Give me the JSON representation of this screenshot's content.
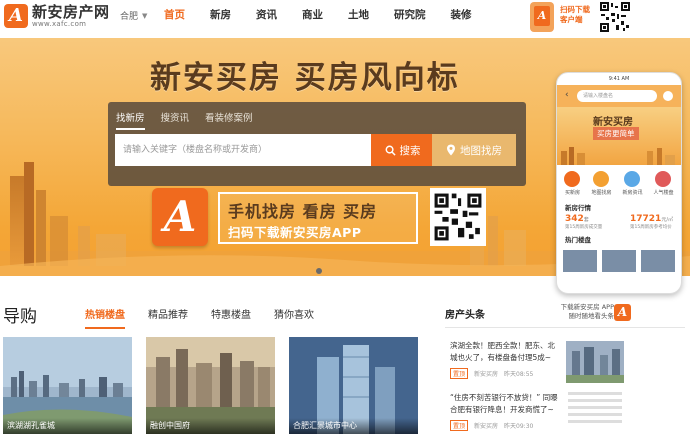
{
  "logo": {
    "name": "新安房产网",
    "url": "www.xafc.com",
    "mark": "A"
  },
  "city": {
    "label": "合肥"
  },
  "nav": {
    "items": [
      "首页",
      "新房",
      "资讯",
      "商业",
      "土地",
      "研究院",
      "装修"
    ],
    "active_index": 0
  },
  "app_download": {
    "line1": "扫码下载",
    "line2": "客户端"
  },
  "banner": {
    "slogan": "新安买房  买房风向标",
    "search": {
      "tabs": [
        "找新房",
        "搜资讯",
        "看装修案例"
      ],
      "active_tab": 0,
      "placeholder": "请输入关键字（楼盘名称或开发商）",
      "search_label": "搜索",
      "map_label": "地图找房"
    },
    "promo": {
      "line1": "手机找房  看房  买房",
      "line2": "扫码下载新安买房APP"
    }
  },
  "phone": {
    "status": "9:41 AM",
    "search_placeholder": "请输入楼盘名",
    "hero_title": "新安买房",
    "hero_sub": "买房更简单",
    "icons": [
      "买新房",
      "地图找房",
      "新房资讯",
      "人气楼盘"
    ],
    "market_title": "新房行情",
    "stat1_value": "342",
    "stat1_unit": "套",
    "stat1_label": "第15周新房成交量",
    "stat2_value": "17721",
    "stat2_unit": "元/㎡",
    "stat2_label": "第15周新房参考均价",
    "hot_title": "热门楼盘"
  },
  "guide": {
    "title": "导购",
    "tabs": [
      "热销楼盘",
      "精品推荐",
      "特惠楼盘",
      "猜你喜欢"
    ],
    "active_tab": 0,
    "cards": [
      {
        "caption": "滨湖湖孔雀城"
      },
      {
        "caption": "融创中国府"
      },
      {
        "caption": "合肥汇景城市中心"
      }
    ]
  },
  "news": {
    "header": "房产头条",
    "app_line1": "下载新安买房 APP",
    "app_line2": "随时随地看头条",
    "items": [
      {
        "text": "滨湖全款！肥西全款！肥东、北城也火了，有楼盘备付理5成~",
        "tag": "置顶",
        "source": "新安买房",
        "time": "昨天08:55"
      },
      {
        "text": "“住房不刻苦银行不放贷！” 同曝合肥有银行降息！开发商慌了~",
        "tag": "置顶",
        "source": "新安买房",
        "time": "昨天09:30"
      }
    ]
  },
  "colors": {
    "accent": "#f06a1e",
    "banner": "#f4a636",
    "search_panel": "#50463c"
  }
}
